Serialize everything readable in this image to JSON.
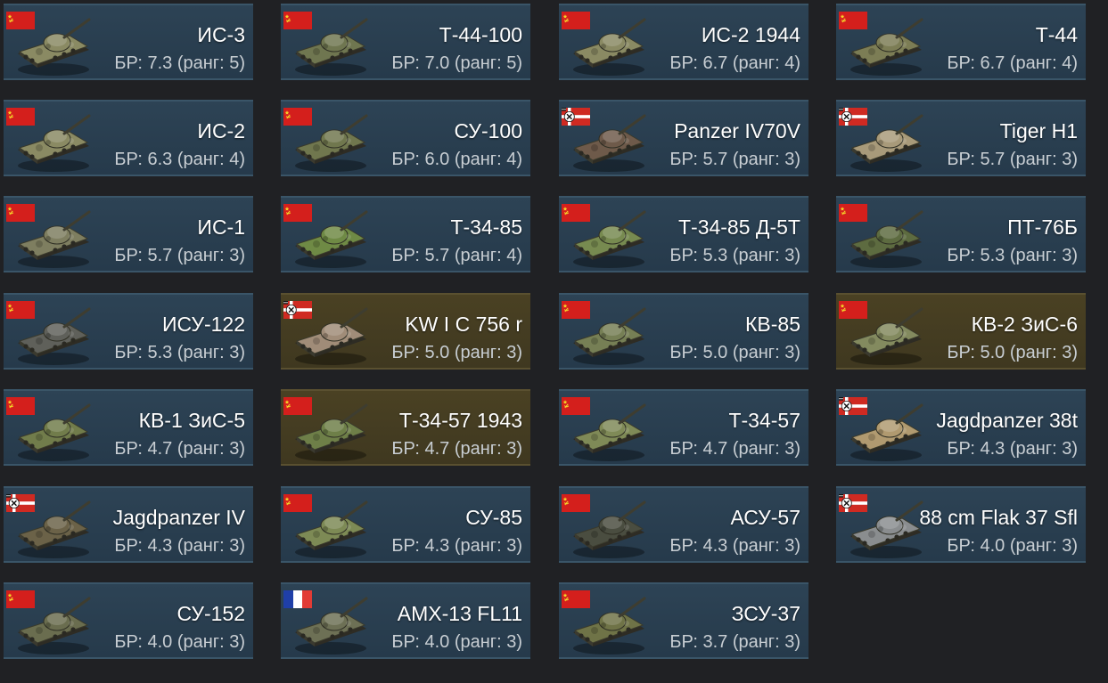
{
  "vehicles": [
    {
      "name": "ИС-3",
      "br": "БР: 7.3 (ранг: 5)",
      "nation": "ussr",
      "premium": false,
      "camo": "#8a8a63"
    },
    {
      "name": "Т-44-100",
      "br": "БР: 7.0 (ранг: 5)",
      "nation": "ussr",
      "premium": false,
      "camo": "#6f7650"
    },
    {
      "name": "ИС-2 1944",
      "br": "БР: 6.7 (ранг: 4)",
      "nation": "ussr",
      "premium": false,
      "camo": "#8a8a63"
    },
    {
      "name": "Т-44",
      "br": "БР: 6.7 (ранг: 4)",
      "nation": "ussr",
      "premium": false,
      "camo": "#7c7d55"
    },
    {
      "name": "ИС-2",
      "br": "БР: 6.3 (ранг: 4)",
      "nation": "ussr",
      "premium": false,
      "camo": "#8a8a63"
    },
    {
      "name": "СУ-100",
      "br": "БР: 6.0 (ранг: 4)",
      "nation": "ussr",
      "premium": false,
      "camo": "#70774e"
    },
    {
      "name": "Panzer IV70V",
      "br": "БР: 5.7 (ранг: 3)",
      "nation": "germany",
      "premium": false,
      "camo": "#6e5a4a"
    },
    {
      "name": "Tiger H1",
      "br": "БР: 5.7 (ранг: 3)",
      "nation": "germany",
      "premium": false,
      "camo": "#a89a7a"
    },
    {
      "name": "ИС-1",
      "br": "БР: 5.7 (ранг: 3)",
      "nation": "ussr",
      "premium": false,
      "camo": "#7e7e60"
    },
    {
      "name": "Т-34-85",
      "br": "БР: 5.7 (ранг: 4)",
      "nation": "ussr",
      "premium": false,
      "camo": "#6f8a45"
    },
    {
      "name": "Т-34-85 Д-5Т",
      "br": "БР: 5.3 (ранг: 3)",
      "nation": "ussr",
      "premium": false,
      "camo": "#778a50"
    },
    {
      "name": "ПТ-76Б",
      "br": "БР: 5.3 (ранг: 3)",
      "nation": "ussr",
      "premium": false,
      "camo": "#5d6b40"
    },
    {
      "name": "ИСУ-122",
      "br": "БР: 5.3 (ранг: 3)",
      "nation": "ussr",
      "premium": false,
      "camo": "#5f605a"
    },
    {
      "name": "KW I C 756 r",
      "br": "БР: 5.0 (ранг: 3)",
      "nation": "germany",
      "premium": true,
      "camo": "#a08c78"
    },
    {
      "name": "КВ-85",
      "br": "БР: 5.0 (ранг: 3)",
      "nation": "ussr",
      "premium": false,
      "camo": "#767f55"
    },
    {
      "name": "КВ-2 ЗиС-6",
      "br": "БР: 5.0 (ранг: 3)",
      "nation": "ussr",
      "premium": true,
      "camo": "#838a5f"
    },
    {
      "name": "КВ-1 ЗиС-5",
      "br": "БР: 4.7 (ранг: 3)",
      "nation": "ussr",
      "premium": false,
      "camo": "#717c4b"
    },
    {
      "name": "Т-34-57 1943",
      "br": "БР: 4.7 (ранг: 3)",
      "nation": "ussr",
      "premium": true,
      "camo": "#6e7f48"
    },
    {
      "name": "Т-34-57",
      "br": "БР: 4.7 (ранг: 3)",
      "nation": "ussr",
      "premium": false,
      "camo": "#7f8a57"
    },
    {
      "name": "Jagdpanzer 38t",
      "br": "БР: 4.3 (ранг: 3)",
      "nation": "germany",
      "premium": false,
      "camo": "#b09a70"
    },
    {
      "name": "Jagdpanzer IV",
      "br": "БР: 4.3 (ранг: 3)",
      "nation": "germany",
      "premium": false,
      "camo": "#6b6248"
    },
    {
      "name": "СУ-85",
      "br": "БР: 4.3 (ранг: 3)",
      "nation": "ussr",
      "premium": false,
      "camo": "#7d8a55"
    },
    {
      "name": "АСУ-57",
      "br": "БР: 4.3 (ранг: 3)",
      "nation": "ussr",
      "premium": false,
      "camo": "#4a4d40"
    },
    {
      "name": "88 cm Flak 37 Sfl",
      "br": "БР: 4.0 (ранг: 3)",
      "nation": "germany",
      "premium": false,
      "camo": "#8a8d8f"
    },
    {
      "name": "СУ-152",
      "br": "БР: 4.0 (ранг: 3)",
      "nation": "ussr",
      "premium": false,
      "camo": "#6a6d4f"
    },
    {
      "name": "AMX-13 FL11",
      "br": "БР: 4.0 (ранг: 3)",
      "nation": "france",
      "premium": false,
      "camo": "#6d7055"
    },
    {
      "name": "ЗСУ-37",
      "br": "БР: 3.7 (ранг: 3)",
      "nation": "ussr",
      "premium": false,
      "camo": "#6f7347"
    }
  ]
}
